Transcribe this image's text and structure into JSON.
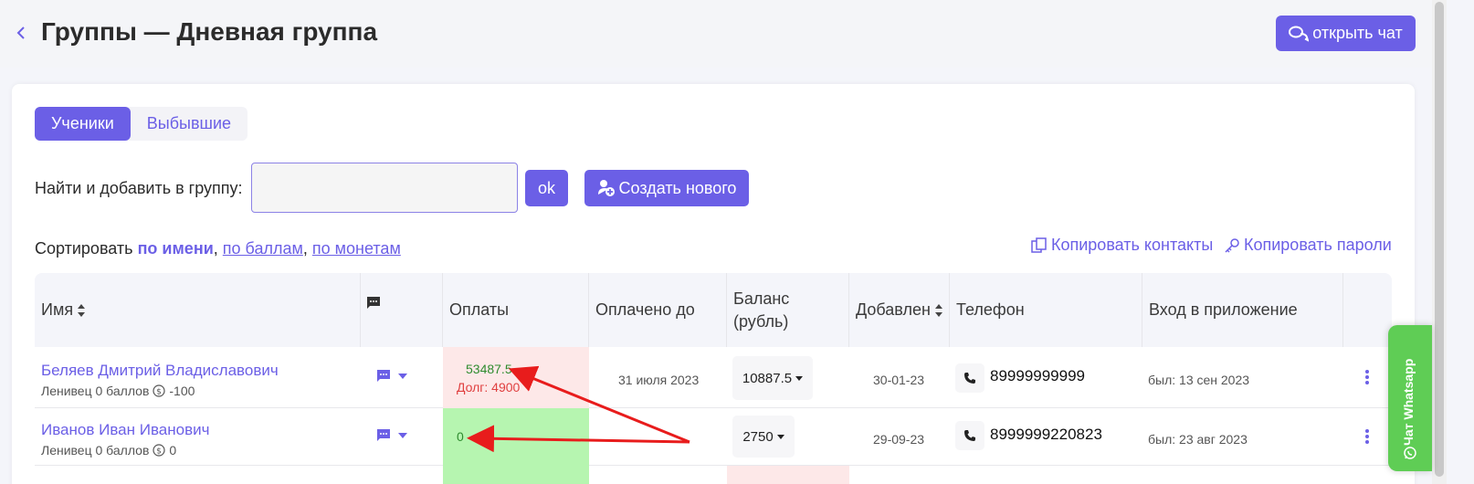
{
  "header": {
    "title": "Группы — Дневная группа",
    "open_chat_label": "открыть чат"
  },
  "tabs": [
    {
      "label": "Ученики",
      "active": true
    },
    {
      "label": "Выбывшие",
      "active": false
    }
  ],
  "search": {
    "label": "Найти и добавить в группу:",
    "value": "",
    "ok_label": "ok",
    "create_label": "Создать нового"
  },
  "sort": {
    "prefix": "Сортировать",
    "by_name": "по имени",
    "by_points": "по баллам",
    "by_coins": "по монетам",
    "sep": ","
  },
  "actions": {
    "copy_contacts": "Копировать контакты",
    "copy_passwords": "Копировать пароли"
  },
  "table": {
    "columns": [
      "Имя",
      "",
      "Оплаты",
      "Оплачено до",
      "Баланс (рубль)",
      "Добавлен",
      "Телефон",
      "Вход в приложение"
    ],
    "balance_line1": "Баланс",
    "balance_line2": "(рубль)",
    "rows": [
      {
        "name": "Беляев Дмитрий Владиславович",
        "rank": "Ленивец 0 баллов",
        "coins": "-100",
        "pay_sum": "53487.5",
        "pay_debt": "Долг: 4900",
        "paid_until": "31 июля 2023",
        "balance": "10887.5",
        "added": "30-01-23",
        "phone": "89999999999",
        "login": "был: 13 сен 2023"
      },
      {
        "name": "Иванов Иван Иванович",
        "rank": "Ленивец 0 баллов",
        "coins": "0",
        "pay_sum": "0",
        "pay_debt": "",
        "paid_until": "",
        "balance": "2750",
        "added": "29-09-23",
        "phone": "8999999220823",
        "login": "был: 23 авг 2023"
      }
    ]
  },
  "whatsapp": {
    "label": "Чат Whatsapp"
  },
  "colors": {
    "accent": "#6b5fe6",
    "debt_bg": "#fde8e8",
    "paid_bg": "#b6f5b0",
    "whatsapp": "#5fcd55",
    "annotation_arrow": "#e81c1c"
  }
}
